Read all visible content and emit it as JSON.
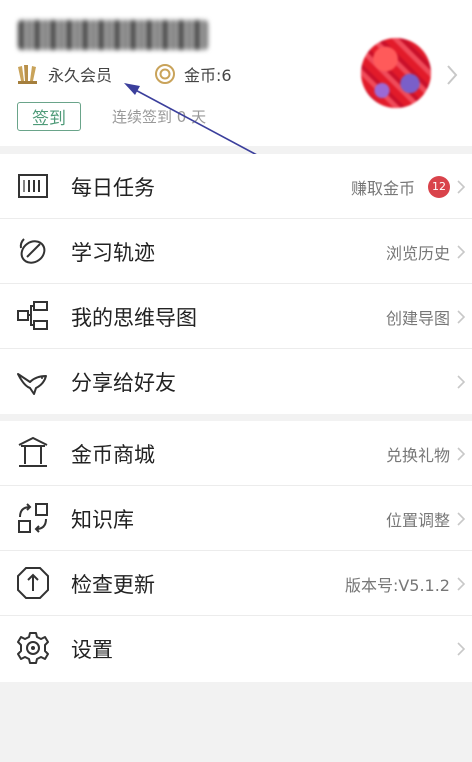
{
  "profile": {
    "membership": "永久会员",
    "coins": "金币:6",
    "checkin_button": "签到",
    "streak": "连续签到 0 天"
  },
  "menu_group_1": [
    {
      "label": "每日任务",
      "detail": "赚取金币",
      "badge": "12",
      "icon": "calendar-icon"
    },
    {
      "label": "学习轨迹",
      "detail": "浏览历史",
      "icon": "satellite-dish-icon"
    },
    {
      "label": "我的思维导图",
      "detail": "创建导图",
      "icon": "mindmap-icon"
    },
    {
      "label": "分享给好友",
      "detail": "",
      "icon": "dove-icon"
    }
  ],
  "menu_group_2": [
    {
      "label": "金币商城",
      "detail": "兑换礼物",
      "icon": "pavilion-icon"
    },
    {
      "label": "知识库",
      "detail": "位置调整",
      "icon": "reorder-icon"
    },
    {
      "label": "检查更新",
      "detail": "版本号:V5.1.2",
      "icon": "upload-icon"
    },
    {
      "label": "设置",
      "detail": "",
      "icon": "gear-icon"
    }
  ],
  "colors": {
    "accent_green": "#4e9a78",
    "badge_red": "#d9434b",
    "annotation_arrow": "#3b3f9c",
    "background": "#f2f2f2"
  }
}
